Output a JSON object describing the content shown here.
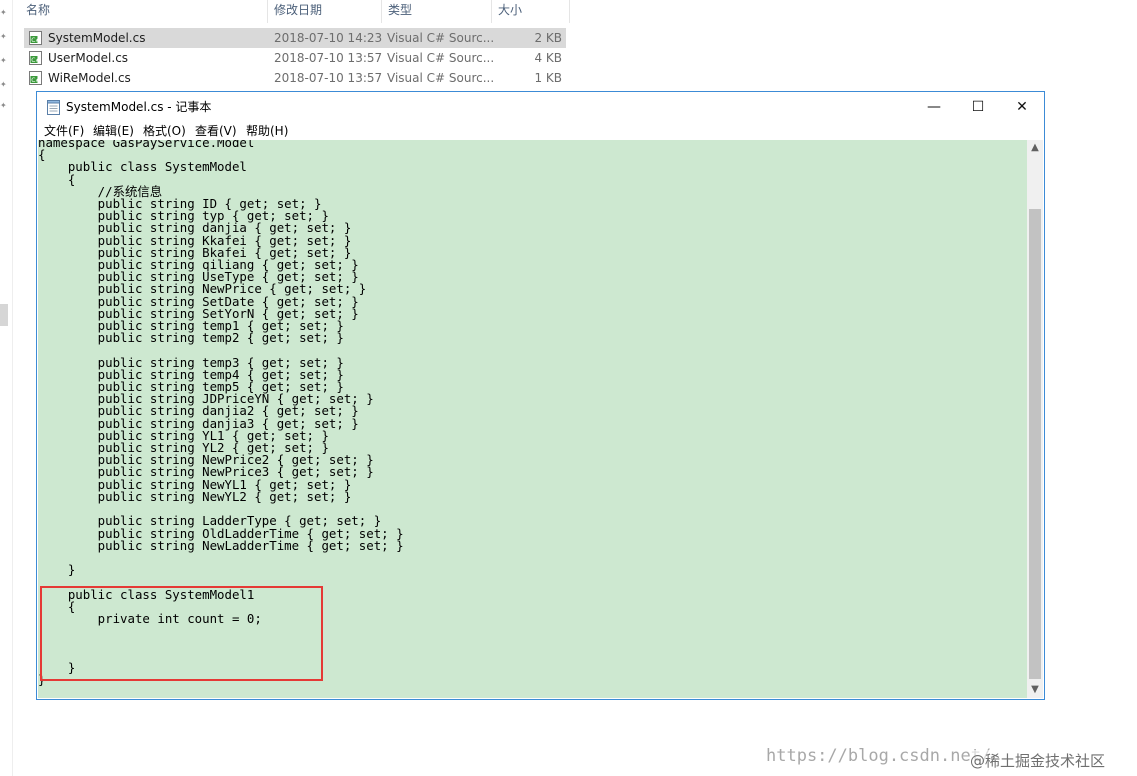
{
  "explorer": {
    "columns": {
      "name": "名称",
      "modified": "修改日期",
      "type": "类型",
      "size": "大小"
    },
    "files": [
      {
        "name": "SystemModel.cs",
        "modified": "2018-07-10 14:23",
        "type": "Visual C# Sourc...",
        "size": "2 KB",
        "selected": true
      },
      {
        "name": "UserModel.cs",
        "modified": "2018-07-10 13:57",
        "type": "Visual C# Sourc...",
        "size": "4 KB",
        "selected": false
      },
      {
        "name": "WiReModel.cs",
        "modified": "2018-07-10 13:57",
        "type": "Visual C# Sourc...",
        "size": "1 KB",
        "selected": false
      }
    ],
    "pin_glyph": "✦"
  },
  "notepad": {
    "title": "SystemModel.cs - 记事本",
    "menu": [
      "文件(F)",
      "编辑(E)",
      "格式(O)",
      "查看(V)",
      "帮助(H)"
    ],
    "controls": {
      "minimize": "—",
      "maximize": "☐",
      "close": "✕"
    },
    "scroll_up": "▲",
    "scroll_down": "▼",
    "editor_bg": "#cde8d0",
    "code": "namespace GasPayService.Model\n{\n    public class SystemModel\n    {\n        //系统信息\n        public string ID { get; set; }\n        public string typ { get; set; }\n        public string danjia { get; set; }\n        public string Kkafei { get; set; }\n        public string Bkafei { get; set; }\n        public string qiliang { get; set; }\n        public string UseType { get; set; }\n        public string NewPrice { get; set; }\n        public string SetDate { get; set; }\n        public string SetYorN { get; set; }\n        public string temp1 { get; set; }\n        public string temp2 { get; set; }\n\n        public string temp3 { get; set; }\n        public string temp4 { get; set; }\n        public string temp5 { get; set; }\n        public string JDPriceYN { get; set; }\n        public string danjia2 { get; set; }\n        public string danjia3 { get; set; }\n        public string YL1 { get; set; }\n        public string YL2 { get; set; }\n        public string NewPrice2 { get; set; }\n        public string NewPrice3 { get; set; }\n        public string NewYL1 { get; set; }\n        public string NewYL2 { get; set; }\n\n        public string LadderType { get; set; }\n        public string OldLadderTime { get; set; }\n        public string NewLadderTime { get; set; }\n\n    }\n\n    public class SystemModel1\n    {\n        private int count = 0;\n\n\n\n    }\n}"
  },
  "annotation_color": "#e53935",
  "watermark": "https://blog.csdn.net/",
  "watermark2": "@稀土掘金技术社区"
}
